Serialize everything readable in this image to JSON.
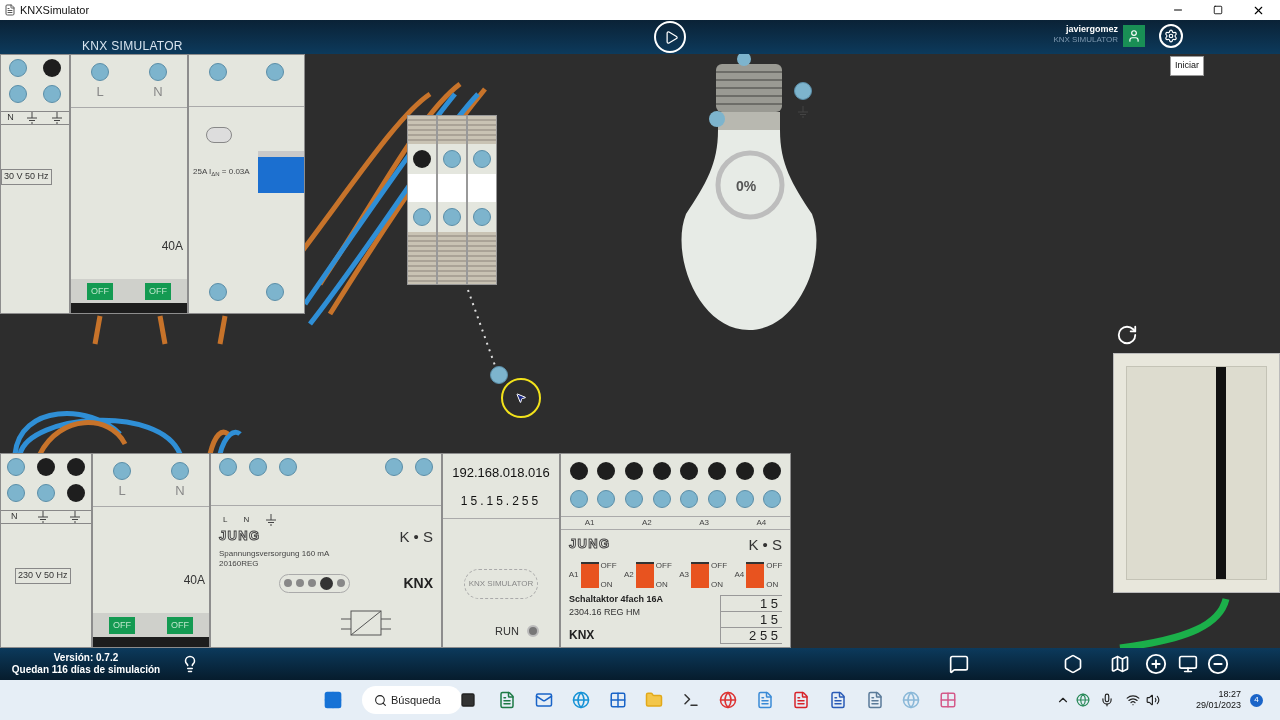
{
  "window": {
    "title": "KNXSimulator"
  },
  "header": {
    "logo": "KNX SIMULATOR",
    "user_name": "javiergomez",
    "user_subtitle": "KNX SIMULATOR",
    "tooltip": "Iniciar"
  },
  "top_devices": {
    "supply": {
      "label": "N",
      "voltage": "30 V 50 Hz"
    },
    "breaker": {
      "terminals": [
        "L",
        "N"
      ],
      "rating": "40A",
      "toggles": [
        "OFF",
        "OFF"
      ]
    },
    "rcd": {
      "spec": "25A I$_{ΔN}$ = 0.03A",
      "on": true
    }
  },
  "wall_switch": {
    "on": false
  },
  "bulb": {
    "reading": "0%"
  },
  "bottom_devices": {
    "supply": {
      "label": "N",
      "voltage": "230 V 50 Hz"
    },
    "breaker": {
      "terminals": [
        "L",
        "N"
      ],
      "rating": "40A",
      "toggles": [
        "OFF",
        "OFF"
      ]
    },
    "power_supply": {
      "terminals": [
        "L",
        "N"
      ],
      "brand": "JUNG",
      "name": "Spannungsversorgung 160 mA",
      "model": "20160REG",
      "maker": "K • S",
      "logo": "KNX"
    },
    "ip_interface": {
      "ip": "192.168.018.016",
      "address": "15.15.255",
      "logo": "KNX SIMULATOR",
      "status": "RUN"
    },
    "actuator": {
      "brand": "JUNG",
      "maker": "K • S",
      "name": "Schaltaktor 4fach 16A",
      "model": "2304.16 REG HM",
      "logo": "KNX",
      "output_labels": [
        "A1",
        "A2",
        "A3",
        "A4"
      ],
      "channels": [
        {
          "label": "A1",
          "off": "OFF",
          "on": "ON",
          "switched_on": false
        },
        {
          "label": "A2",
          "off": "OFF",
          "on": "ON",
          "switched_on": false
        },
        {
          "label": "A3",
          "off": "OFF",
          "on": "ON",
          "switched_on": false
        },
        {
          "label": "A4",
          "off": "OFF",
          "on": "ON",
          "switched_on": false
        }
      ],
      "address_rows": [
        "1 5",
        "1 5",
        "2 5 5"
      ]
    }
  },
  "status_bar": {
    "version": "Versión: 0.7.2",
    "remaining": "Quedan 116 días de simulación"
  },
  "taskbar": {
    "search": "Búsqueda",
    "time": "18:27",
    "date": "29/01/2023",
    "notifications": "4"
  }
}
